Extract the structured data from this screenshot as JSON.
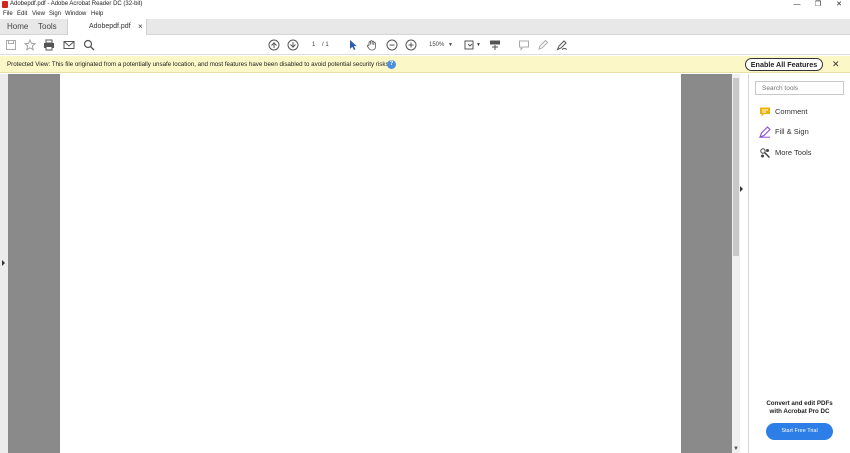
{
  "window": {
    "title": "Adobepdf.pdf - Adobe Acrobat Reader DC (32-bit)",
    "minimize": "—",
    "restore": "❐",
    "close": "✕"
  },
  "menu": [
    "File",
    "Edit",
    "View",
    "Sign",
    "Window",
    "Help"
  ],
  "tabs": {
    "home": "Home",
    "tools": "Tools",
    "document": "Adobepdf.pdf",
    "document_close": "×"
  },
  "toolbar": {
    "page_current": "1",
    "page_total": "/ 1",
    "zoom": "150%",
    "icons": [
      "save-icon",
      "bookmark-star-icon",
      "print-icon",
      "email-icon",
      "search-icon",
      "prev-page-icon",
      "next-page-icon",
      "select-cursor-icon",
      "hand-icon",
      "zoom-out-icon",
      "zoom-in-icon",
      "page-fit-icon",
      "scroll-mode-icon",
      "comment-icon",
      "highlight-pen-icon",
      "sign-icon"
    ]
  },
  "banner": {
    "message": "Protected View: This file originated from a potentially unsafe location, and most features have been disabled to avoid potential security risks.",
    "help": "?",
    "enable_button": "Enable All Features",
    "close": "✕"
  },
  "sidepanel": {
    "search_placeholder": "Search tools",
    "tools": [
      {
        "label": "Comment",
        "icon": "comment-icon",
        "color": "#f0b000"
      },
      {
        "label": "Fill & Sign",
        "icon": "fill-sign-icon",
        "color": "#8a4fd1"
      },
      {
        "label": "More Tools",
        "icon": "more-tools-icon",
        "color": "#444444"
      }
    ],
    "promo_line1": "Convert and edit PDFs",
    "promo_line2": "with Acrobat Pro DC",
    "trial_button": "Start Free Trial"
  },
  "colors": {
    "banner_bg": "#fbf7c6",
    "trial_button": "#2d7ee6",
    "pdf_icon": "#d4251c"
  }
}
